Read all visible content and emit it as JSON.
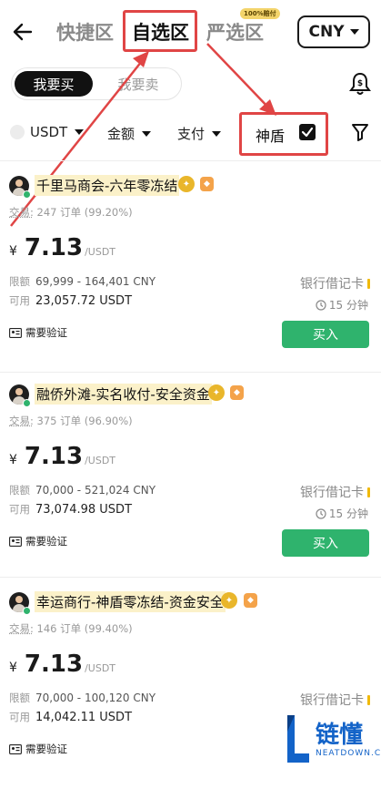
{
  "header": {
    "tabs": [
      {
        "label": "快捷区"
      },
      {
        "label": "自选区"
      },
      {
        "label": "严选区"
      }
    ],
    "strict_badge": "100%赔付",
    "currency": "CNY"
  },
  "toggle": {
    "buy": "我要买",
    "sell": "我要卖"
  },
  "filters": {
    "coin": "USDT",
    "amount": "金额",
    "payment": "支付",
    "shield": "神盾",
    "shield_checked": true
  },
  "offers": [
    {
      "name": "千里马商会-六年零冻结",
      "trades_label": "交易:",
      "trades": "247 订单 (99.20%)",
      "currency_symbol": "¥",
      "price": "7.13",
      "price_unit": "/USDT",
      "limit_label": "限额",
      "limit": "69,999 - 164,401 CNY",
      "available_label": "可用",
      "available": "23,057.72 USDT",
      "payment_method": "银行借记卡",
      "pay_time": "15 分钟",
      "buy_label": "买入",
      "verify_label": "需要验证"
    },
    {
      "name": "融侨外滩-实名收付-安全资金",
      "trades_label": "交易:",
      "trades": "375 订单 (96.90%)",
      "currency_symbol": "¥",
      "price": "7.13",
      "price_unit": "/USDT",
      "limit_label": "限额",
      "limit": "70,000 - 521,024 CNY",
      "available_label": "可用",
      "available": "73,074.98 USDT",
      "payment_method": "银行借记卡",
      "pay_time": "15 分钟",
      "buy_label": "买入",
      "verify_label": "需要验证"
    },
    {
      "name": "幸运商行-神盾零冻结-资金安全",
      "trades_label": "交易:",
      "trades": "146 订单 (99.40%)",
      "currency_symbol": "¥",
      "price": "7.13",
      "price_unit": "/USDT",
      "limit_label": "限额",
      "limit": "70,000 - 100,120 CNY",
      "available_label": "可用",
      "available": "14,042.11 USDT",
      "payment_method": "银行借记卡",
      "pay_time": "",
      "buy_label": "",
      "verify_label": "需要验证"
    }
  ],
  "watermark": {
    "text": "链懂",
    "sub": "NEATDOWN.COM"
  },
  "colors": {
    "accent_green": "#2fb36d",
    "annotation_red": "#e04545",
    "highlight": "#fbf1c9"
  }
}
